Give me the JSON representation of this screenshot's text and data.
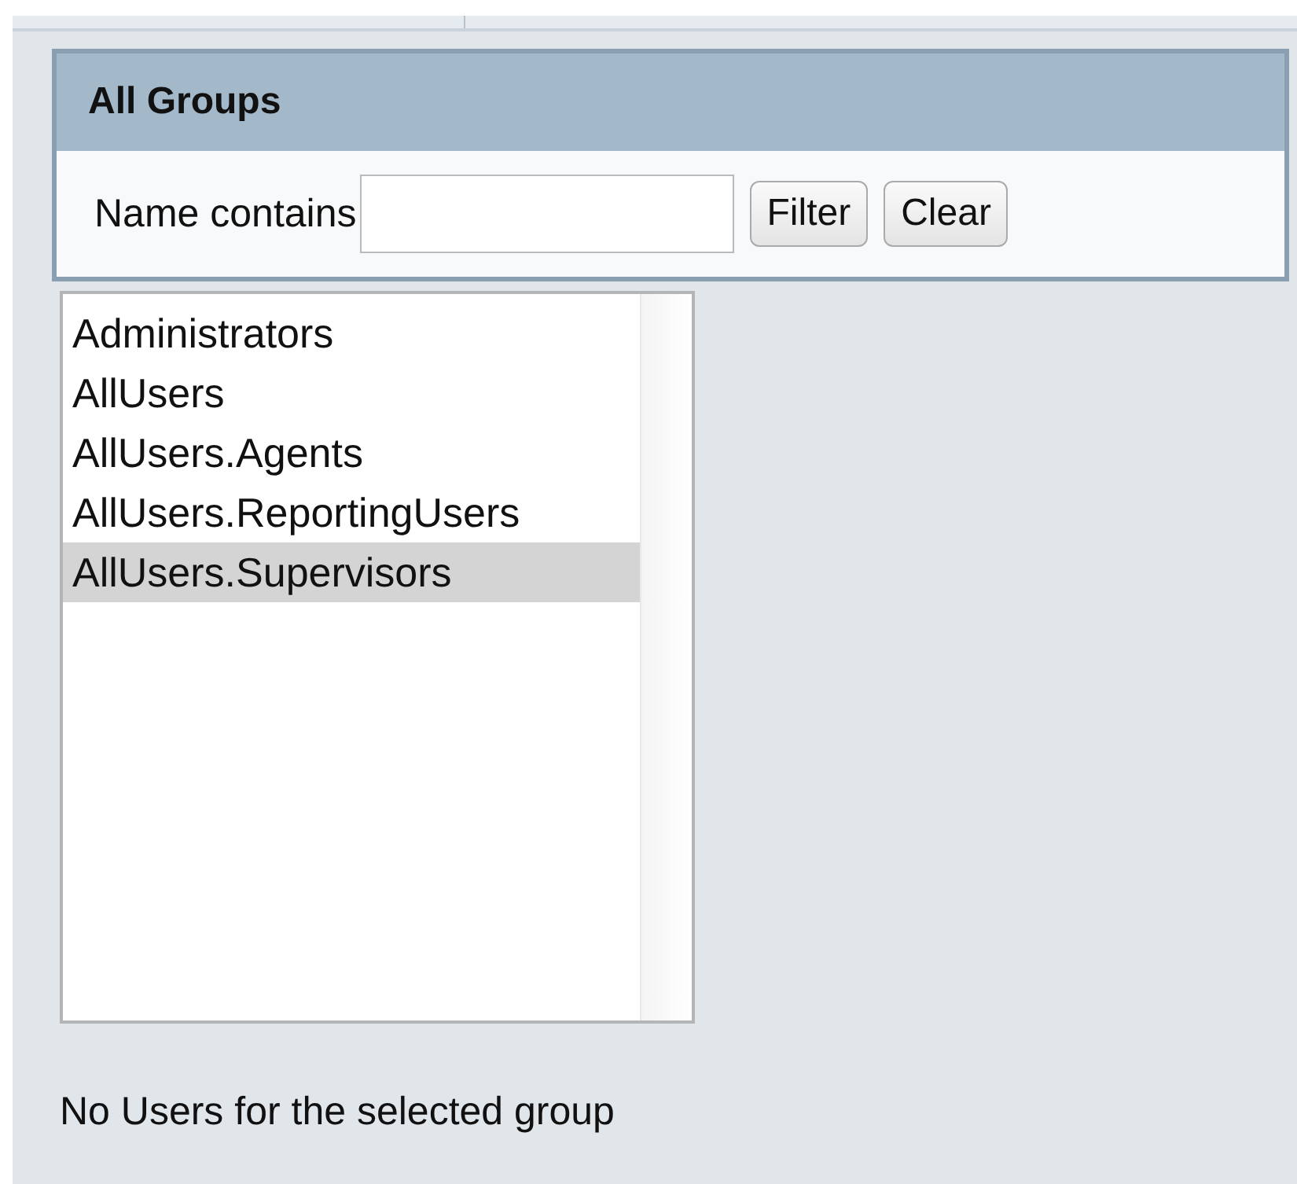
{
  "panel": {
    "title": "All Groups",
    "filter_label": "Name contains",
    "buttons": [
      {
        "label": "Filter"
      },
      {
        "label": "Clear"
      }
    ]
  },
  "groups": [
    {
      "label": "Administrators",
      "selected": false
    },
    {
      "label": "AllUsers",
      "selected": false
    },
    {
      "label": "AllUsers.Agents",
      "selected": false
    },
    {
      "label": "AllUsers.ReportingUsers",
      "selected": false
    },
    {
      "label": "AllUsers.Supervisors",
      "selected": true
    }
  ],
  "message": "No Users for the selected group"
}
